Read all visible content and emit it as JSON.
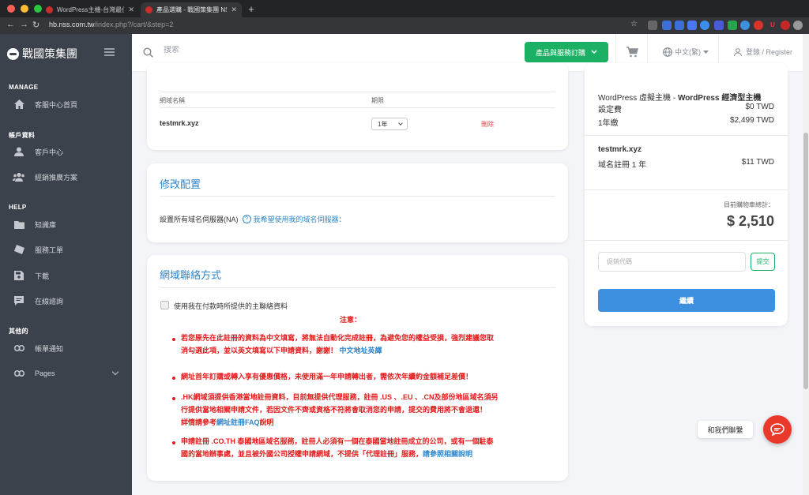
{
  "browser": {
    "tabs": [
      {
        "title": "WordPress主機-台灣最佳WordP"
      },
      {
        "title": "產品選購 - 戰國策集團 NSS Gro"
      }
    ],
    "url_host": "hb.nss.com.tw",
    "url_path": "/index.php?/cart/&step=2"
  },
  "sidebar": {
    "logo": "戰國策集團",
    "sections": [
      {
        "label": "MANAGE",
        "items": [
          {
            "label": "客服中心首頁",
            "icon": "home-icon"
          }
        ]
      },
      {
        "label": "帳戶資料",
        "items": [
          {
            "label": "客戶中心",
            "icon": "user-icon"
          },
          {
            "label": "經銷推廣方案",
            "icon": "users-icon"
          }
        ]
      },
      {
        "label": "HELP",
        "items": [
          {
            "label": "知識庫",
            "icon": "folder-icon"
          },
          {
            "label": "服務工單",
            "icon": "ticket-icon"
          },
          {
            "label": "下載",
            "icon": "save-icon"
          },
          {
            "label": "在線諮詢",
            "icon": "chat-icon"
          }
        ]
      },
      {
        "label": "其他的",
        "items": [
          {
            "label": "帳單通知",
            "icon": "link-icon"
          },
          {
            "label": "Pages",
            "icon": "link-icon"
          }
        ]
      }
    ]
  },
  "header": {
    "search_placeholder": "搜索",
    "order_button": "產品與服務訂購",
    "language": "中文(繁)",
    "login": "登錄 / Register"
  },
  "domains_table": {
    "col_name": "網域名稱",
    "col_period": "期限",
    "rows": [
      {
        "name": "testmrk.xyz",
        "period": "1年",
        "delete": "刪除"
      }
    ]
  },
  "config": {
    "title": "修改配置",
    "ns_label": "設置所有域名伺服器(NA)",
    "ns_link": "我希望使用我的域名伺服器："
  },
  "contact_section": {
    "title": "網域聯絡方式",
    "checkbox_label": "使用我在付款時所提供的主聯絡資料",
    "notice_title": "注意：",
    "notes": {
      "n1_line1": "若您原先在此註冊的資料為中文填寫，將無法自動化完成註冊，為避免您的權益受損，強烈建議您取",
      "n1_line2": "消勾選此項，並以英文填寫以下申請資料，謝謝！",
      "n1_link": "中文地址英譯",
      "n2": "網址首年訂購或轉入享有優惠價格，未使用滿一年申請轉出者，需依次年續約金額補足差價！",
      "n3_line1": ".HK網域須提供香港當地註冊資料，目前無提供代理服務，註冊 .US 、.EU 、.CN及部份地區域名須另",
      "n3_line2": "行提供當地相關申請文件，若因文件不齊或資格不符將會取消您的申請，提交的費用將不會退還！",
      "n3_line3a": "詳情請參考",
      "n3_link": "網址註冊FAQ",
      "n3_line3b": "說明",
      "n4_line1": "申請註冊 .CO.TH 泰國地區域名服務，註冊人必須有一個在泰國當地註冊成立的公司，或有一個駐泰",
      "n4_line2a": "國的當地辦事處，並且被外國公司授權申請網域，不提供「代理註冊」服務，",
      "n4_link": "請參照相關說明"
    }
  },
  "summary": {
    "product_prefix": "WordPress 虛擬主機 - ",
    "product_bold": "WordPress 經濟型主機",
    "setup_label": "設定費",
    "setup_value": "$0 TWD",
    "annual_label": "1年繳",
    "annual_value": "$2,499 TWD",
    "domain_name": "testmrk.xyz",
    "domain_label": "域名註冊 1 年",
    "domain_value": "$11 TWD",
    "total_label": "目前購物車總計：",
    "total_value": "$ 2,510",
    "promo_placeholder": "促銷代碼",
    "promo_button": "提交",
    "continue_button": "繼續"
  },
  "chat": {
    "label": "和我們聯繫"
  },
  "colors": {
    "accent": "#2e86c9",
    "green": "#1cb064",
    "warning": "#e31b1b",
    "sidebar": "#3c424b"
  }
}
